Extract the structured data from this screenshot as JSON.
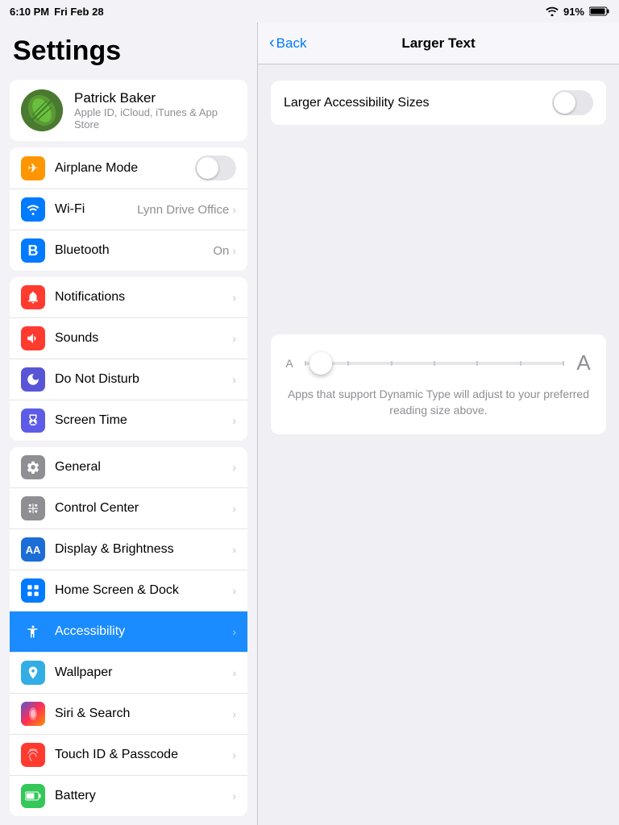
{
  "statusBar": {
    "time": "6:10 PM",
    "date": "Fri Feb 28",
    "battery": "91%"
  },
  "sidebar": {
    "title": "Settings",
    "profile": {
      "name": "Patrick Baker",
      "subtitle": "Apple ID, iCloud, iTunes & App Store"
    },
    "groups": [
      {
        "id": "connectivity",
        "items": [
          {
            "id": "airplane-mode",
            "label": "Airplane Mode",
            "iconColor": "orange",
            "iconSymbol": "✈",
            "hasToggle": true,
            "toggleOn": false
          },
          {
            "id": "wifi",
            "label": "Wi-Fi",
            "iconColor": "blue",
            "iconSymbol": "wifi",
            "value": "Lynn Drive Office"
          },
          {
            "id": "bluetooth",
            "label": "Bluetooth",
            "iconColor": "blue-bt",
            "iconSymbol": "bt",
            "value": "On"
          }
        ]
      },
      {
        "id": "notifications",
        "items": [
          {
            "id": "notifications",
            "label": "Notifications",
            "iconColor": "red",
            "iconSymbol": "bell"
          },
          {
            "id": "sounds",
            "label": "Sounds",
            "iconColor": "red-sound",
            "iconSymbol": "sound"
          },
          {
            "id": "do-not-disturb",
            "label": "Do Not Disturb",
            "iconColor": "purple",
            "iconSymbol": "moon"
          },
          {
            "id": "screen-time",
            "label": "Screen Time",
            "iconColor": "dark-purple",
            "iconSymbol": "hourglass"
          }
        ]
      },
      {
        "id": "system",
        "items": [
          {
            "id": "general",
            "label": "General",
            "iconColor": "gray",
            "iconSymbol": "gear"
          },
          {
            "id": "control-center",
            "label": "Control Center",
            "iconColor": "gray",
            "iconSymbol": "sliders"
          },
          {
            "id": "display-brightness",
            "label": "Display & Brightness",
            "iconColor": "blue-dark",
            "iconSymbol": "AA"
          },
          {
            "id": "home-screen-dock",
            "label": "Home Screen & Dock",
            "iconColor": "blue-home",
            "iconSymbol": "grid"
          },
          {
            "id": "accessibility",
            "label": "Accessibility",
            "iconColor": "blue-access",
            "iconSymbol": "person",
            "active": true
          },
          {
            "id": "wallpaper",
            "label": "Wallpaper",
            "iconColor": "cyan",
            "iconSymbol": "flower"
          },
          {
            "id": "siri-search",
            "label": "Siri & Search",
            "iconColor": "dark-siri",
            "iconSymbol": "siri"
          },
          {
            "id": "touch-id-passcode",
            "label": "Touch ID & Passcode",
            "iconColor": "red-touch",
            "iconSymbol": "fingerprint"
          },
          {
            "id": "battery",
            "label": "Battery",
            "iconColor": "green",
            "iconSymbol": "battery"
          }
        ]
      }
    ]
  },
  "detail": {
    "backLabel": "Back",
    "title": "Larger Text",
    "rows": [
      {
        "id": "larger-accessibility-sizes",
        "label": "Larger Accessibility Sizes",
        "hasToggle": true,
        "toggleOn": false
      }
    ],
    "sliderDesc": "Apps that support Dynamic Type will adjust to your preferred reading size above.",
    "sliderASmall": "A",
    "sliderALarge": "A"
  }
}
